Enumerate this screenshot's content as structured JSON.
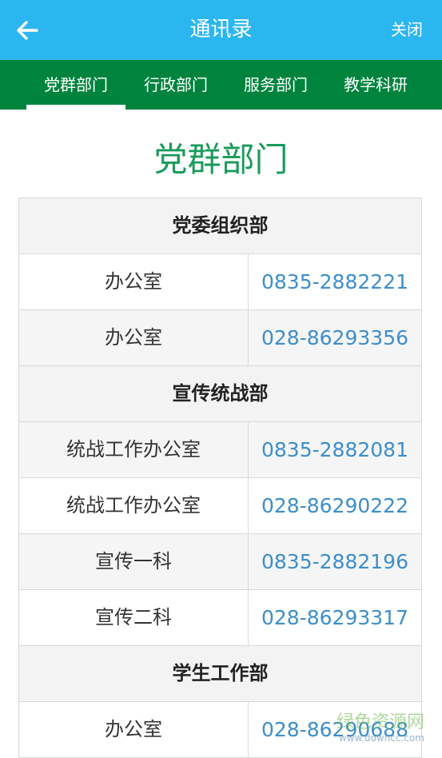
{
  "header": {
    "back_icon": "back-arrow-icon",
    "title": "通讯录",
    "close_label": "关闭",
    "bg_color": "#2cb6f0"
  },
  "tabs": {
    "bg_color": "#00843d",
    "active_index": 0,
    "items": [
      {
        "label": "党群部门"
      },
      {
        "label": "行政部门"
      },
      {
        "label": "服务部门"
      },
      {
        "label": "教学科研"
      }
    ]
  },
  "section": {
    "title": "党群部门",
    "title_color": "#1a9a5c"
  },
  "groups": [
    {
      "name": "党委组织部",
      "entries": [
        {
          "office": "办公室",
          "phone": "0835-2882221"
        },
        {
          "office": "办公室",
          "phone": "028-86293356"
        }
      ]
    },
    {
      "name": "宣传统战部",
      "entries": [
        {
          "office": "统战工作办公室",
          "phone": "0835-2882081"
        },
        {
          "office": "统战工作办公室",
          "phone": "028-86290222"
        },
        {
          "office": "宣传一科",
          "phone": "0835-2882196"
        },
        {
          "office": "宣传二科",
          "phone": "028-86293317"
        }
      ]
    },
    {
      "name": "学生工作部",
      "entries": [
        {
          "office": "办公室",
          "phone": "028-86290688"
        }
      ]
    }
  ],
  "watermark": {
    "text": "绿色资源网",
    "sub": "www.downcc.com"
  }
}
